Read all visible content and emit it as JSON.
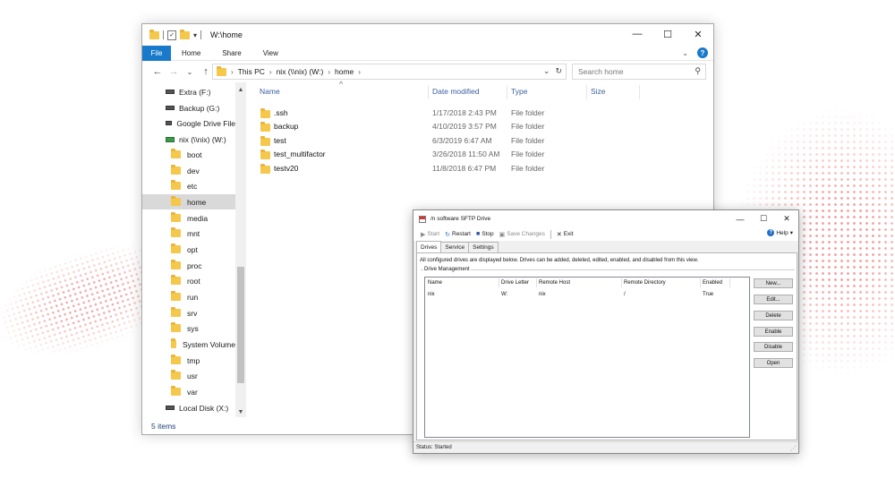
{
  "explorer": {
    "title": "W:\\home",
    "controls": {
      "minimize": "—",
      "maximize": "☐",
      "close": "✕"
    },
    "ribbon": {
      "file": "File",
      "tabs": [
        "Home",
        "Share",
        "View"
      ]
    },
    "address": {
      "parts": [
        "This PC",
        "nix (\\\\nix) (W:)",
        "home"
      ]
    },
    "search_placeholder": "Search home",
    "nav": [
      {
        "label": "Extra (F:)",
        "icon": "drive-icon"
      },
      {
        "label": "Backup (G:)",
        "icon": "drive-icon"
      },
      {
        "label": "Google Drive File",
        "icon": "drive-icon"
      },
      {
        "label": "nix (\\\\nix) (W:)",
        "icon": "network-drive-icon"
      },
      {
        "label": "boot",
        "icon": "folder-icon"
      },
      {
        "label": "dev",
        "icon": "folder-icon"
      },
      {
        "label": "etc",
        "icon": "folder-icon"
      },
      {
        "label": "home",
        "icon": "folder-icon",
        "selected": true
      },
      {
        "label": "media",
        "icon": "folder-icon"
      },
      {
        "label": "mnt",
        "icon": "folder-icon"
      },
      {
        "label": "opt",
        "icon": "folder-icon"
      },
      {
        "label": "proc",
        "icon": "folder-icon"
      },
      {
        "label": "root",
        "icon": "folder-icon"
      },
      {
        "label": "run",
        "icon": "folder-icon"
      },
      {
        "label": "srv",
        "icon": "folder-icon"
      },
      {
        "label": "sys",
        "icon": "folder-icon"
      },
      {
        "label": "System Volume",
        "icon": "folder-icon"
      },
      {
        "label": "tmp",
        "icon": "folder-icon"
      },
      {
        "label": "usr",
        "icon": "folder-icon"
      },
      {
        "label": "var",
        "icon": "folder-icon"
      },
      {
        "label": "Local Disk (X:)",
        "icon": "drive-icon"
      }
    ],
    "columns": {
      "name": "Name",
      "date": "Date modified",
      "type": "Type",
      "size": "Size"
    },
    "files": [
      {
        "name": ".ssh",
        "date": "1/17/2018 2:43 PM",
        "type": "File folder"
      },
      {
        "name": "backup",
        "date": "4/10/2019 3:57 PM",
        "type": "File folder"
      },
      {
        "name": "test",
        "date": "6/3/2019 6:47 AM",
        "type": "File folder"
      },
      {
        "name": "test_multifactor",
        "date": "3/26/2018 11:50 AM",
        "type": "File folder"
      },
      {
        "name": "testv20",
        "date": "11/8/2018 6:47 PM",
        "type": "File folder"
      }
    ],
    "status": "5 items"
  },
  "sftp": {
    "title": "/n software SFTP Drive",
    "controls": {
      "minimize": "—",
      "maximize": "☐",
      "close": "✕"
    },
    "toolbar": {
      "start": "Start",
      "restart": "Restart",
      "stop": "Stop",
      "save": "Save Changes",
      "exit": "Exit",
      "help": "Help"
    },
    "tabs": [
      "Drives",
      "Service",
      "Settings"
    ],
    "description": "All configured drives are displayed below. Drives can be added, deleted, edited, enabled, and disabled from this view.",
    "group_label": "Drive Management",
    "list_columns": [
      "Name",
      "Drive Letter",
      "Remote Host",
      "Remote Directory",
      "Enabled"
    ],
    "rows": [
      {
        "name": "nix",
        "letter": "W:",
        "host": "nix",
        "dir": "/",
        "enabled": "True"
      }
    ],
    "buttons": {
      "new": "New...",
      "edit": "Edit...",
      "delete": "Delete",
      "enable": "Enable",
      "disable": "Disable",
      "open": "Open"
    },
    "status": "Status: Started"
  },
  "colors": {
    "accent": "#1979ca",
    "folder": "#f5c84c",
    "wave": "#e65a5a"
  }
}
